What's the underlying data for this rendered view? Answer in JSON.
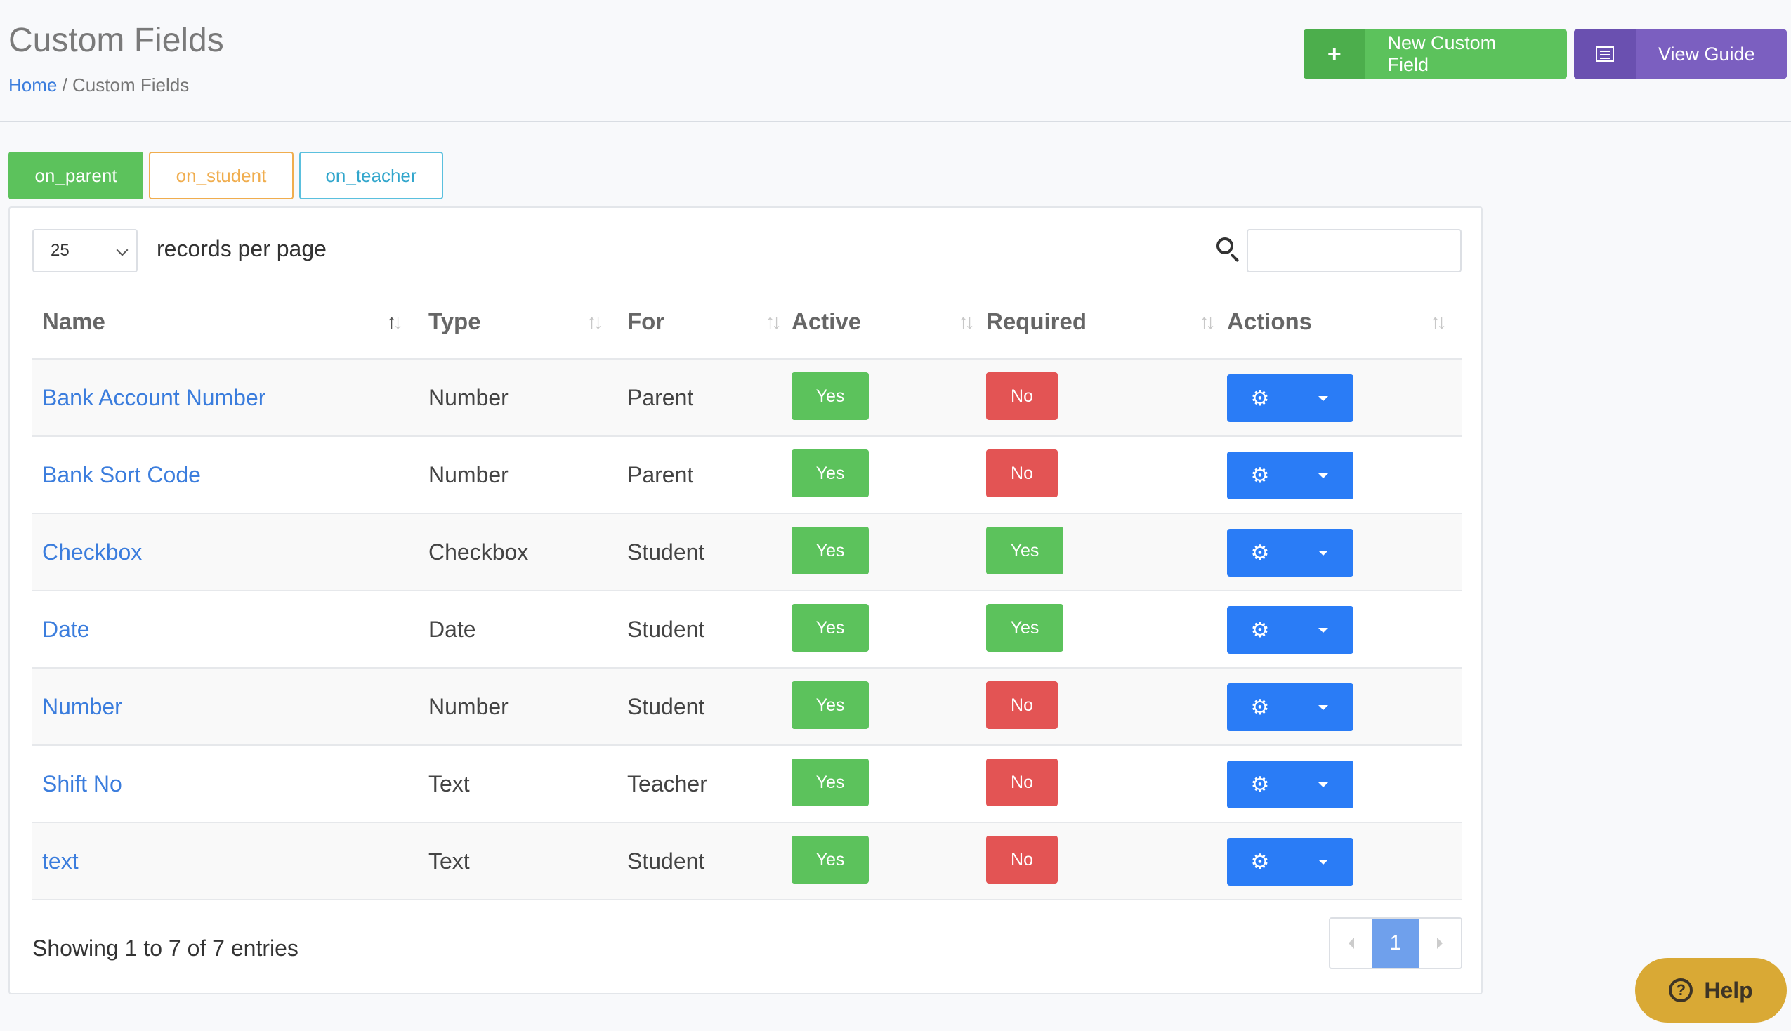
{
  "header": {
    "title": "Custom Fields",
    "breadcrumb_home": "Home",
    "breadcrumb_sep": " / ",
    "breadcrumb_current": "Custom Fields",
    "new_button_icon": "+",
    "new_button_label": "New Custom Field",
    "guide_button_label": "View Guide"
  },
  "tabs": [
    {
      "label": "on_parent"
    },
    {
      "label": "on_student"
    },
    {
      "label": "on_teacher"
    }
  ],
  "controls": {
    "per_page_value": "25",
    "per_page_label": "records per page",
    "search_value": ""
  },
  "table": {
    "columns": [
      "Name",
      "Type",
      "For",
      "Active",
      "Required",
      "Actions"
    ],
    "rows": [
      {
        "name": "Bank Account Number",
        "type": "Number",
        "for": "Parent",
        "active": "Yes",
        "required": "No"
      },
      {
        "name": "Bank Sort Code",
        "type": "Number",
        "for": "Parent",
        "active": "Yes",
        "required": "No"
      },
      {
        "name": "Checkbox",
        "type": "Checkbox",
        "for": "Student",
        "active": "Yes",
        "required": "Yes"
      },
      {
        "name": "Date",
        "type": "Date",
        "for": "Student",
        "active": "Yes",
        "required": "Yes"
      },
      {
        "name": "Number",
        "type": "Number",
        "for": "Student",
        "active": "Yes",
        "required": "No"
      },
      {
        "name": "Shift No",
        "type": "Text",
        "for": "Teacher",
        "active": "Yes",
        "required": "No"
      },
      {
        "name": "text",
        "type": "Text",
        "for": "Student",
        "active": "Yes",
        "required": "No"
      }
    ]
  },
  "footer": {
    "info": "Showing 1 to 7 of 7 entries",
    "current_page": "1"
  },
  "help": {
    "label": "Help",
    "icon": "?"
  },
  "colors": {
    "green": "#5cc25c",
    "red": "#e35454",
    "blue": "#2a7cf6",
    "purple": "#7b5fc0",
    "link": "#3b7ddd",
    "help": "#d9a935"
  }
}
